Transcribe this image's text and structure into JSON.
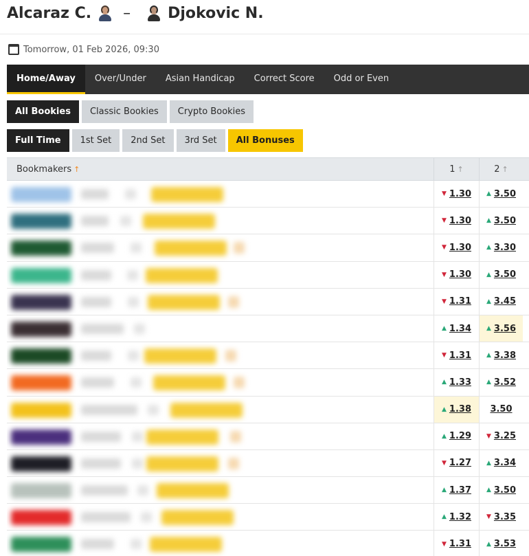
{
  "match": {
    "player_home": "Alcaraz C.",
    "separator": "–",
    "player_away": "Djokovic N.",
    "datetime": "Tomorrow, 01 Feb 2026, 09:30"
  },
  "market_tabs": [
    "Home/Away",
    "Over/Under",
    "Asian Handicap",
    "Correct Score",
    "Odd or Even"
  ],
  "bookie_filters": [
    "All Bookies",
    "Classic Bookies",
    "Crypto Bookies"
  ],
  "period_filters": [
    "Full Time",
    "1st Set",
    "2nd Set",
    "3rd Set"
  ],
  "bonus_filter": "All Bonuses",
  "table": {
    "col_bookmakers": "Bookmakers",
    "col_1": "1",
    "col_2": "2",
    "rows": [
      {
        "odd1": "1.30",
        "move1": "down",
        "odd2": "3.50",
        "move2": "up",
        "logo_color": "#9fc3e8"
      },
      {
        "odd1": "1.30",
        "move1": "down",
        "odd2": "3.50",
        "move2": "up",
        "logo_color": "#2f6f7f"
      },
      {
        "odd1": "1.30",
        "move1": "down",
        "odd2": "3.30",
        "move2": "up",
        "logo_color": "#1f5a32"
      },
      {
        "odd1": "1.30",
        "move1": "down",
        "odd2": "3.50",
        "move2": "up",
        "logo_color": "#3cb68c"
      },
      {
        "odd1": "1.31",
        "move1": "down",
        "odd2": "3.45",
        "move2": "up",
        "logo_color": "#3a3450"
      },
      {
        "odd1": "1.34",
        "move1": "up",
        "odd2": "3.56",
        "move2": "up",
        "highlight2": true,
        "logo_color": "#3b2f33"
      },
      {
        "odd1": "1.31",
        "move1": "down",
        "odd2": "3.38",
        "move2": "up",
        "logo_color": "#1c4a25"
      },
      {
        "odd1": "1.33",
        "move1": "up",
        "odd2": "3.52",
        "move2": "up",
        "logo_color": "#f26a21"
      },
      {
        "odd1": "1.38",
        "move1": "up",
        "odd2": "3.50",
        "move2": "none",
        "highlight1": true,
        "logo_color": "#f3c21c"
      },
      {
        "odd1": "1.29",
        "move1": "up",
        "odd2": "3.25",
        "move2": "down",
        "logo_color": "#4b2f7d"
      },
      {
        "odd1": "1.27",
        "move1": "down",
        "odd2": "3.34",
        "move2": "up",
        "logo_color": "#1e1e26"
      },
      {
        "odd1": "1.37",
        "move1": "up",
        "odd2": "3.50",
        "move2": "up",
        "logo_color": "#b8c2bc"
      },
      {
        "odd1": "1.32",
        "move1": "up",
        "odd2": "3.35",
        "move2": "down",
        "logo_color": "#e32b2b"
      },
      {
        "odd1": "1.31",
        "move1": "down",
        "odd2": "3.53",
        "move2": "up",
        "logo_color": "#2e8f5a"
      }
    ]
  }
}
